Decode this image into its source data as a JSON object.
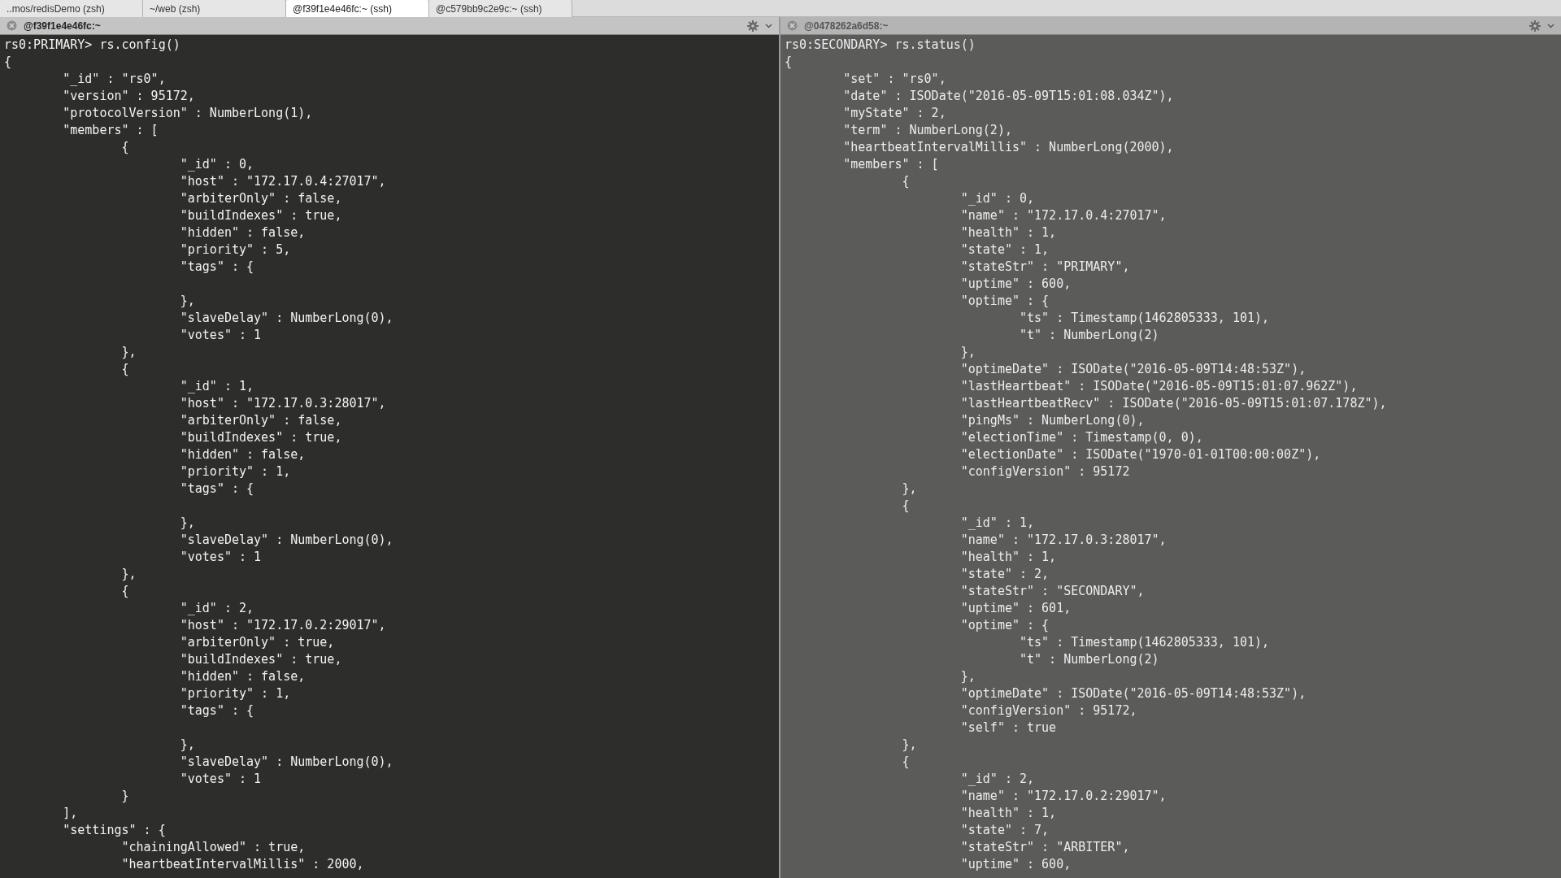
{
  "tabs": [
    {
      "label": "..mos/redisDemo (zsh)",
      "selected": false
    },
    {
      "label": "~/web (zsh)",
      "selected": false
    },
    {
      "label": "@f39f1e4e46fc:~ (ssh)",
      "selected": true
    },
    {
      "label": "@c579bb9c2e9c:~ (ssh)",
      "selected": false
    }
  ],
  "panes": [
    {
      "title": "@f39f1e4e46fc:~",
      "active": true,
      "lines": [
        {
          "kind": "text",
          "text": "rs0:PRIMARY> rs.config()"
        },
        {
          "kind": "text",
          "text": "{"
        },
        {
          "kind": "text",
          "text": "\t\"_id\" : \"rs0\","
        },
        {
          "kind": "text",
          "text": "\t\"version\" : 95172,"
        },
        {
          "kind": "text",
          "text": "\t\"protocolVersion\" : NumberLong(1),"
        },
        {
          "kind": "text",
          "text": "\t\"members\" : ["
        },
        {
          "kind": "text",
          "text": "\t\t{"
        },
        {
          "kind": "text",
          "text": "\t\t\t\"_id\" : 0,"
        },
        {
          "kind": "text",
          "text": "\t\t\t\"host\" : \"172.17.0.4:27017\","
        },
        {
          "kind": "text",
          "text": "\t\t\t\"arbiterOnly\" : false,"
        },
        {
          "kind": "text",
          "text": "\t\t\t\"buildIndexes\" : true,"
        },
        {
          "kind": "text",
          "text": "\t\t\t\"hidden\" : false,"
        },
        {
          "kind": "text",
          "text": "\t\t\t\"priority\" : 5,"
        },
        {
          "kind": "text",
          "text": "\t\t\t\"tags\" : {"
        },
        {
          "kind": "blank"
        },
        {
          "kind": "text",
          "text": "\t\t\t},"
        },
        {
          "kind": "text",
          "text": "\t\t\t\"slaveDelay\" : NumberLong(0),"
        },
        {
          "kind": "text",
          "text": "\t\t\t\"votes\" : 1"
        },
        {
          "kind": "text",
          "text": "\t\t},"
        },
        {
          "kind": "text",
          "text": "\t\t{"
        },
        {
          "kind": "text",
          "text": "\t\t\t\"_id\" : 1,"
        },
        {
          "kind": "text",
          "text": "\t\t\t\"host\" : \"172.17.0.3:28017\","
        },
        {
          "kind": "text",
          "text": "\t\t\t\"arbiterOnly\" : false,"
        },
        {
          "kind": "text",
          "text": "\t\t\t\"buildIndexes\" : true,"
        },
        {
          "kind": "text",
          "text": "\t\t\t\"hidden\" : false,"
        },
        {
          "kind": "text",
          "text": "\t\t\t\"priority\" : 1,"
        },
        {
          "kind": "text",
          "text": "\t\t\t\"tags\" : {"
        },
        {
          "kind": "blank"
        },
        {
          "kind": "text",
          "text": "\t\t\t},"
        },
        {
          "kind": "text",
          "text": "\t\t\t\"slaveDelay\" : NumberLong(0),"
        },
        {
          "kind": "text",
          "text": "\t\t\t\"votes\" : 1"
        },
        {
          "kind": "text",
          "text": "\t\t},"
        },
        {
          "kind": "text",
          "text": "\t\t{"
        },
        {
          "kind": "text",
          "text": "\t\t\t\"_id\" : 2,"
        },
        {
          "kind": "text",
          "text": "\t\t\t\"host\" : \"172.17.0.2:29017\","
        },
        {
          "kind": "text",
          "text": "\t\t\t\"arbiterOnly\" : true,"
        },
        {
          "kind": "text",
          "text": "\t\t\t\"buildIndexes\" : true,"
        },
        {
          "kind": "text",
          "text": "\t\t\t\"hidden\" : false,"
        },
        {
          "kind": "text",
          "text": "\t\t\t\"priority\" : 1,"
        },
        {
          "kind": "text",
          "text": "\t\t\t\"tags\" : {"
        },
        {
          "kind": "blank"
        },
        {
          "kind": "text",
          "text": "\t\t\t},"
        },
        {
          "kind": "text",
          "text": "\t\t\t\"slaveDelay\" : NumberLong(0),"
        },
        {
          "kind": "text",
          "text": "\t\t\t\"votes\" : 1"
        },
        {
          "kind": "text",
          "text": "\t\t}"
        },
        {
          "kind": "text",
          "text": "\t],"
        },
        {
          "kind": "text",
          "text": "\t\"settings\" : {"
        },
        {
          "kind": "text",
          "text": "\t\t\"chainingAllowed\" : true,"
        },
        {
          "kind": "text",
          "text": "\t\t\"heartbeatIntervalMillis\" : 2000,"
        }
      ]
    },
    {
      "title": "@0478262a6d58:~",
      "active": false,
      "lines": [
        {
          "kind": "text",
          "text": "rs0:SECONDARY> rs.status()"
        },
        {
          "kind": "text",
          "text": "{"
        },
        {
          "kind": "text",
          "text": "\t\"set\" : \"rs0\","
        },
        {
          "kind": "text",
          "text": "\t\"date\" : ISODate(\"2016-05-09T15:01:08.034Z\"),"
        },
        {
          "kind": "text",
          "text": "\t\"myState\" : 2,"
        },
        {
          "kind": "text",
          "text": "\t\"term\" : NumberLong(2),"
        },
        {
          "kind": "text",
          "text": "\t\"heartbeatIntervalMillis\" : NumberLong(2000),"
        },
        {
          "kind": "text",
          "text": "\t\"members\" : ["
        },
        {
          "kind": "text",
          "text": "\t\t{"
        },
        {
          "kind": "text",
          "text": "\t\t\t\"_id\" : 0,"
        },
        {
          "kind": "text",
          "text": "\t\t\t\"name\" : \"172.17.0.4:27017\","
        },
        {
          "kind": "text",
          "text": "\t\t\t\"health\" : 1,"
        },
        {
          "kind": "text",
          "text": "\t\t\t\"state\" : 1,"
        },
        {
          "kind": "text",
          "text": "\t\t\t\"stateStr\" : \"PRIMARY\","
        },
        {
          "kind": "text",
          "text": "\t\t\t\"uptime\" : 600,"
        },
        {
          "kind": "text",
          "text": "\t\t\t\"optime\" : {"
        },
        {
          "kind": "text",
          "text": "\t\t\t\t\"ts\" : Timestamp(1462805333, 101),"
        },
        {
          "kind": "text",
          "text": "\t\t\t\t\"t\" : NumberLong(2)"
        },
        {
          "kind": "text",
          "text": "\t\t\t},"
        },
        {
          "kind": "text",
          "text": "\t\t\t\"optimeDate\" : ISODate(\"2016-05-09T14:48:53Z\"),"
        },
        {
          "kind": "text",
          "text": "\t\t\t\"lastHeartbeat\" : ISODate(\"2016-05-09T15:01:07.962Z\"),"
        },
        {
          "kind": "text",
          "text": "\t\t\t\"lastHeartbeatRecv\" : ISODate(\"2016-05-09T15:01:07.178Z\"),"
        },
        {
          "kind": "text",
          "text": "\t\t\t\"pingMs\" : NumberLong(0),"
        },
        {
          "kind": "text",
          "text": "\t\t\t\"electionTime\" : Timestamp(0, 0),"
        },
        {
          "kind": "text",
          "text": "\t\t\t\"electionDate\" : ISODate(\"1970-01-01T00:00:00Z\"),"
        },
        {
          "kind": "text",
          "text": "\t\t\t\"configVersion\" : 95172"
        },
        {
          "kind": "text",
          "text": "\t\t},"
        },
        {
          "kind": "text",
          "text": "\t\t{"
        },
        {
          "kind": "text",
          "text": "\t\t\t\"_id\" : 1,"
        },
        {
          "kind": "text",
          "text": "\t\t\t\"name\" : \"172.17.0.3:28017\","
        },
        {
          "kind": "text",
          "text": "\t\t\t\"health\" : 1,"
        },
        {
          "kind": "text",
          "text": "\t\t\t\"state\" : 2,"
        },
        {
          "kind": "text",
          "text": "\t\t\t\"stateStr\" : \"SECONDARY\","
        },
        {
          "kind": "text",
          "text": "\t\t\t\"uptime\" : 601,"
        },
        {
          "kind": "text",
          "text": "\t\t\t\"optime\" : {"
        },
        {
          "kind": "text",
          "text": "\t\t\t\t\"ts\" : Timestamp(1462805333, 101),"
        },
        {
          "kind": "text",
          "text": "\t\t\t\t\"t\" : NumberLong(2)"
        },
        {
          "kind": "text",
          "text": "\t\t\t},"
        },
        {
          "kind": "text",
          "text": "\t\t\t\"optimeDate\" : ISODate(\"2016-05-09T14:48:53Z\"),"
        },
        {
          "kind": "text",
          "text": "\t\t\t\"configVersion\" : 95172,"
        },
        {
          "kind": "text",
          "text": "\t\t\t\"self\" : true"
        },
        {
          "kind": "text",
          "text": "\t\t},"
        },
        {
          "kind": "text",
          "text": "\t\t{"
        },
        {
          "kind": "text",
          "text": "\t\t\t\"_id\" : 2,"
        },
        {
          "kind": "text",
          "text": "\t\t\t\"name\" : \"172.17.0.2:29017\","
        },
        {
          "kind": "text",
          "text": "\t\t\t\"health\" : 1,"
        },
        {
          "kind": "text",
          "text": "\t\t\t\"state\" : 7,"
        },
        {
          "kind": "text",
          "text": "\t\t\t\"stateStr\" : \"ARBITER\","
        },
        {
          "kind": "text",
          "text": "\t\t\t\"uptime\" : 600,"
        }
      ]
    }
  ]
}
